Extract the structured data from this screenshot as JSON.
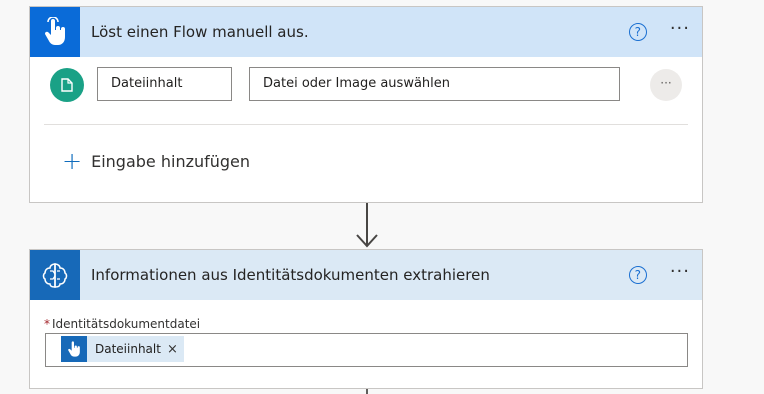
{
  "trigger_card": {
    "title": "Löst einen Flow manuell aus.",
    "help_label": "?",
    "more_label": "···",
    "input_name": "Dateiinhalt",
    "input_file_placeholder": "Datei oder Image auswählen",
    "row_more_label": "···",
    "add_input_plus": "+",
    "add_input_label": "Eingabe hinzufügen"
  },
  "action_card": {
    "title": "Informationen aus Identitätsdokumenten extrahieren",
    "help_label": "?",
    "more_label": "···",
    "required_marker": "*",
    "field_label": "Identitätsdokumentdatei",
    "token_text": "Dateiinhalt",
    "token_remove": "×"
  },
  "colors": {
    "trigger_header": "#d0e4f8",
    "trigger_icon_bg": "#0a6bd8",
    "action_header": "#dbe9f5",
    "action_icon_bg": "#1769b8",
    "file_circle": "#1aa186",
    "accent": "#0f6cbd"
  },
  "icons": {
    "trigger": "hand-touch-icon",
    "file": "file-icon",
    "action": "ai-brain-icon",
    "connector": "arrow-down-icon"
  }
}
